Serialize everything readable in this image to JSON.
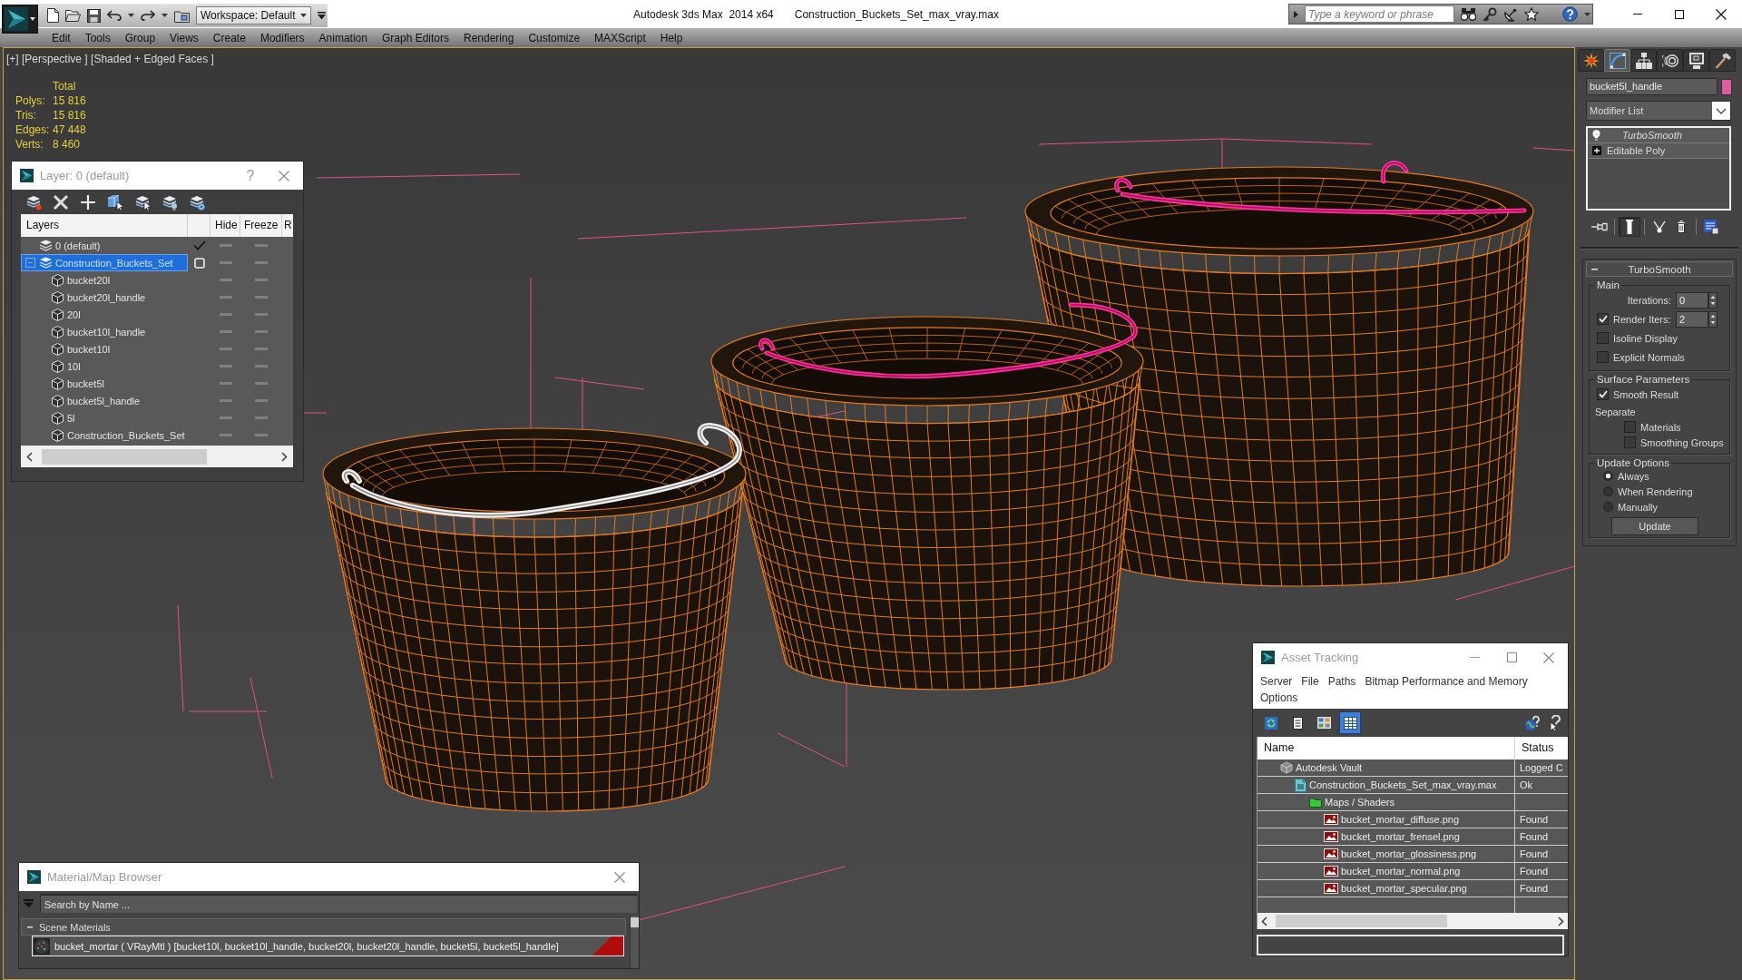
{
  "title_bar": {
    "workspace": "Workspace: Default",
    "app_title": "Autodesk 3ds Max  2014 x64",
    "file_name": "Construction_Buckets_Set_max_vray.max",
    "search": {
      "placeholder": "Type a keyword or phrase"
    }
  },
  "menu_bar": [
    "Edit",
    "Tools",
    "Group",
    "Views",
    "Create",
    "Modifiers",
    "Animation",
    "Graph Editors",
    "Rendering",
    "Customize",
    "MAXScript",
    "Help"
  ],
  "viewport": {
    "label": "[+] [Perspective ] [Shaded + Edged Faces ]",
    "stats": {
      "heading": "Total",
      "rows": [
        {
          "label": "Polys:",
          "value": "15 816"
        },
        {
          "label": "Tris:",
          "value": "15 816"
        },
        {
          "label": "Edges:",
          "value": "47 448"
        },
        {
          "label": "Verts:",
          "value": "8 460"
        }
      ]
    },
    "models": [
      {
        "handle_selected": true
      },
      {
        "handle_selected": false
      },
      {
        "handle_selected": false
      }
    ]
  },
  "layer_dialog": {
    "title": "Layer: 0 (default)",
    "help": "?",
    "columns": [
      "Layers",
      "Hide",
      "Freeze",
      "R"
    ],
    "layers": [
      {
        "name": "0 (default)",
        "current": true,
        "selected": false,
        "expanded": false,
        "hidden": false,
        "frozen": false
      },
      {
        "name": "Construction_Buckets_Set",
        "current": false,
        "selected": true,
        "expanded": true,
        "hidden": false,
        "frozen": false,
        "children": [
          {
            "name": "bucket20l",
            "hidden": false,
            "frozen": false
          },
          {
            "name": "bucket20l_handle",
            "hidden": false,
            "frozen": false
          },
          {
            "name": "20l",
            "hidden": false,
            "frozen": false
          },
          {
            "name": "bucket10l_handle",
            "hidden": false,
            "frozen": false
          },
          {
            "name": "bucket10l",
            "hidden": false,
            "frozen": false
          },
          {
            "name": "10l",
            "hidden": false,
            "frozen": false
          },
          {
            "name": "bucket5l",
            "hidden": false,
            "frozen": false
          },
          {
            "name": "bucket5l_handle",
            "hidden": false,
            "frozen": false
          },
          {
            "name": "5l",
            "hidden": false,
            "frozen": false
          },
          {
            "name": "Construction_Buckets_Set",
            "hidden": false,
            "frozen": false
          }
        ]
      }
    ]
  },
  "command_panel": {
    "tabs": [
      {
        "kind": "create",
        "selected": false
      },
      {
        "kind": "modify",
        "selected": true
      },
      {
        "kind": "hierarchy",
        "selected": false
      },
      {
        "kind": "motion",
        "selected": false
      },
      {
        "kind": "display",
        "selected": false
      },
      {
        "kind": "utilities",
        "selected": false
      }
    ],
    "object": {
      "name": "bucket5l_handle",
      "color": "#dd5b9f"
    },
    "modifier_list": "Modifier List",
    "stack": [
      {
        "name": "TurboSmooth",
        "kind": "modifier"
      },
      {
        "name": "Editable Poly",
        "kind": "base_object"
      }
    ],
    "stack_tools": [
      {
        "kind": "pin",
        "selected": false
      },
      {
        "kind": "end_result",
        "selected": true
      },
      {
        "kind": "make_unique",
        "selected": false
      },
      {
        "kind": "remove",
        "selected": false
      },
      {
        "kind": "configure",
        "selected": false
      }
    ],
    "rollout": {
      "title": "TurboSmooth",
      "expanded": true,
      "groups": [
        {
          "title": "Main",
          "controls": [
            {
              "kind": "spinner",
              "label": "Iterations:",
              "value": "0"
            },
            {
              "kind": "check_spinner",
              "label": "Render Iters:",
              "value": "2",
              "checked": true
            },
            {
              "kind": "checkbox",
              "label": "Isoline Display",
              "checked": false
            },
            {
              "kind": "checkbox",
              "label": "Explicit Normals",
              "checked": false
            }
          ]
        },
        {
          "title": "Surface Parameters",
          "controls": [
            {
              "kind": "checkbox",
              "label": "Smooth Result",
              "checked": true
            },
            {
              "kind": "label",
              "label": "Separate"
            },
            {
              "kind": "sub_checkbox",
              "label": "Materials",
              "checked": false
            },
            {
              "kind": "sub_checkbox",
              "label": "Smoothing Groups",
              "checked": false
            }
          ]
        },
        {
          "title": "Update Options",
          "controls": [
            {
              "kind": "radio",
              "label": "Always",
              "selected": true
            },
            {
              "kind": "radio",
              "label": "When Rendering",
              "selected": false
            },
            {
              "kind": "radio",
              "label": "Manually",
              "selected": false
            },
            {
              "kind": "button",
              "label": "Update"
            }
          ]
        }
      ]
    }
  },
  "asset_tracking": {
    "title": "Asset Tracking",
    "menu": [
      "Server",
      "File",
      "Paths",
      "Bitmap Performance and Memory",
      "Options"
    ],
    "toolbar": [
      {
        "kind": "refresh",
        "selected": false
      },
      {
        "kind": "list",
        "selected": false
      },
      {
        "kind": "thumbnails",
        "selected": false
      },
      {
        "kind": "table",
        "selected": true
      }
    ],
    "columns": [
      "Name",
      "Status"
    ],
    "rows": [
      {
        "kind": "vault",
        "name": "Autodesk Vault",
        "status": "Logged C",
        "children": [
          {
            "kind": "max_file",
            "name": "Construction_Buckets_Set_max_vray.max",
            "status": "Ok",
            "children": [
              {
                "kind": "folder",
                "name": "Maps / Shaders",
                "children": [
                  {
                    "kind": "png",
                    "name": "bucket_mortar_diffuse.png",
                    "status": "Found"
                  },
                  {
                    "kind": "png",
                    "name": "bucket_mortar_frensel.png",
                    "status": "Found"
                  },
                  {
                    "kind": "png",
                    "name": "bucket_mortar_glossiness.png",
                    "status": "Found"
                  },
                  {
                    "kind": "png",
                    "name": "bucket_mortar_normal.png",
                    "status": "Found"
                  },
                  {
                    "kind": "png",
                    "name": "bucket_mortar_specular.png",
                    "status": "Found"
                  }
                ]
              }
            ]
          }
        ]
      }
    ]
  },
  "material_browser": {
    "title": "Material/Map Browser",
    "search": {
      "placeholder": "Search by Name ..."
    },
    "groups": [
      {
        "title": "Scene Materials",
        "expanded": true,
        "materials": [
          {
            "label": "bucket_mortar ( VRayMtl ) [bucket10l, bucket10l_handle, bucket20l, bucket20l_handle, bucket5l, bucket5l_handle]",
            "in_scene": true
          }
        ]
      }
    ]
  }
}
